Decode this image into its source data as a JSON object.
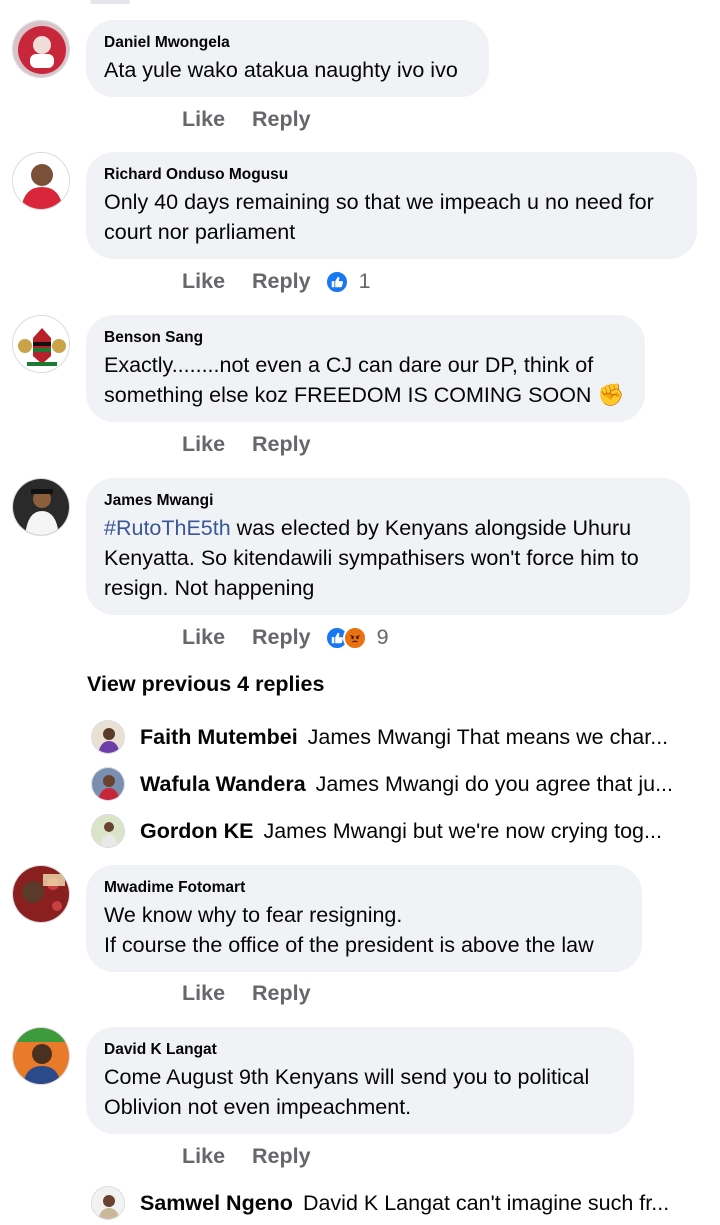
{
  "actions": {
    "like": "Like",
    "reply": "Reply"
  },
  "comments": [
    {
      "author": "Daniel Mwongela",
      "text": "Ata yule wako atakua naughty ivo ivo",
      "reaction_count": ""
    },
    {
      "author": "Richard Onduso Mogusu",
      "text": "Only 40 days remaining so that we impeach u no need for\ncourt nor parliament",
      "reaction_count": "1"
    },
    {
      "author": "Benson Sang",
      "text": "Exactly........not even a CJ can dare our DP, think of\nsomething else koz FREEDOM IS COMING SOON",
      "emoji": "✊",
      "reaction_count": ""
    },
    {
      "author": "James Mwangi",
      "hashtag": "#RutoThE5th",
      "text": " was elected by Kenyans alongside Uhuru\nKenyatta. So kitendawili sympathisers won't force him to\nresign. Not happening",
      "reaction_count": "9"
    },
    {
      "author": "Mwadime Fotomart",
      "text": "We know why to fear resigning.\nIf course the office of the president is above the law",
      "reaction_count": ""
    },
    {
      "author": "David K Langat",
      "text": "Come August 9th Kenyans will send you to political\nOblivion not even impeachment.",
      "reaction_count": ""
    }
  ],
  "view_previous": "View previous 4 replies",
  "replies": [
    {
      "name": "Faith Mutembei",
      "text": "James Mwangi That means we char..."
    },
    {
      "name": "Wafula Wandera",
      "text": "James Mwangi do you agree that ju..."
    },
    {
      "name": "Gordon KE",
      "text": "James Mwangi but we're now crying tog..."
    }
  ],
  "last_reply": {
    "name": "Samwel Ngeno",
    "text": "David K Langat can't imagine such fr..."
  },
  "colors": {
    "bubble": "#f0f2f5",
    "action_text": "#65676b",
    "like_blue": "#1877f2",
    "hashtag": "#385898"
  }
}
